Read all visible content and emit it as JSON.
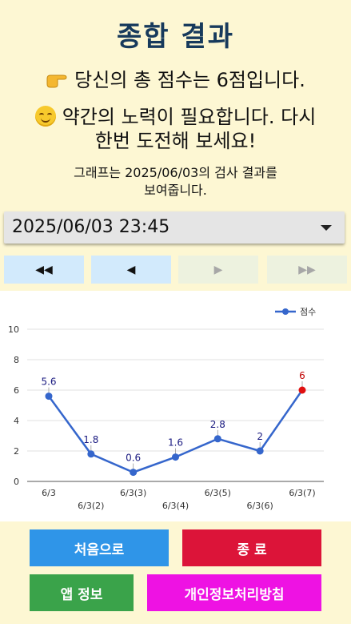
{
  "header": {
    "title": "종합 결과",
    "score_line": "당신의 총 점수는 6점입니다.",
    "advice_line1": "약간의 노력이 필요합니다. 다시",
    "advice_line2": "한번 도전해 보세요!",
    "note_line1": "그래프는 2025/06/03의 검사 결과를",
    "note_line2": "보여줍니다.",
    "icons": {
      "score": "pointing-hand-icon",
      "advice": "smiling-face-icon"
    }
  },
  "date_select": {
    "value": "2025/06/03 23:45"
  },
  "nav": {
    "first": "◀◀",
    "prev": "◀",
    "next": "▶",
    "last": "▶▶"
  },
  "chart_data": {
    "type": "line",
    "categories": [
      "6/3",
      "6/3(2)",
      "6/3(3)",
      "6/3(4)",
      "6/3(5)",
      "6/3(6)",
      "6/3(7)"
    ],
    "series": [
      {
        "name": "점수",
        "values": [
          5.6,
          1.8,
          0.6,
          1.6,
          2.8,
          2,
          6
        ]
      }
    ],
    "ylim": [
      0,
      10
    ],
    "yticks": [
      0,
      2,
      4,
      6,
      8,
      10
    ],
    "grid": true,
    "legend": "top-right",
    "colors": {
      "line": "#3566cc",
      "last_point": "#e01010",
      "label": "#1a1a80",
      "last_label": "#c00000"
    }
  },
  "buttons": {
    "home": "처음으로",
    "exit": "종 료",
    "app_info": "앱 정보",
    "privacy": "개인정보처리방침",
    "colors": {
      "home": "#2f95e8",
      "exit": "#dc1439",
      "app_info": "#3aa34a",
      "privacy": "#ee12e3"
    }
  }
}
